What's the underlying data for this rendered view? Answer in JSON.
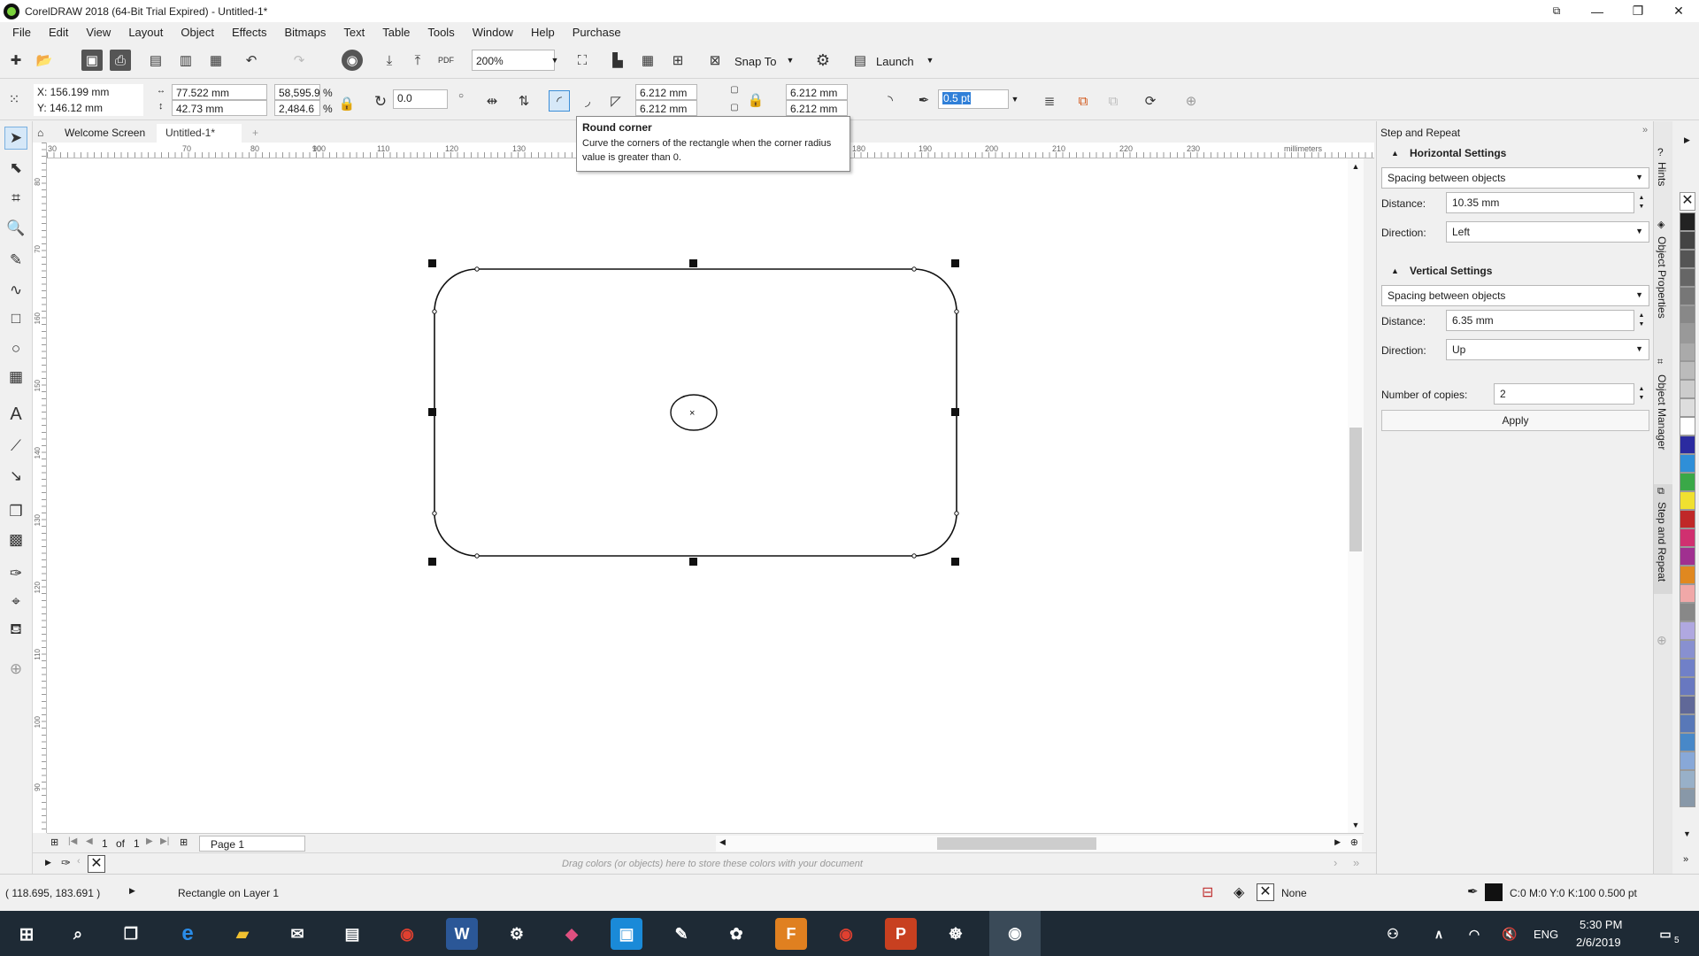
{
  "window": {
    "title": "CorelDRAW 2018 (64-Bit Trial Expired) - Untitled-1*"
  },
  "menu": [
    "File",
    "Edit",
    "View",
    "Layout",
    "Object",
    "Effects",
    "Bitmaps",
    "Text",
    "Table",
    "Tools",
    "Window",
    "Help",
    "Purchase"
  ],
  "toolbar": {
    "zoom": "200%",
    "snap_to": "Snap To",
    "launch": "Launch"
  },
  "propbar": {
    "x": "X: 156.199 mm",
    "y": "Y: 146.12 mm",
    "width": "77.522 mm",
    "height": "42.73 mm",
    "scale_w": "58,595.9",
    "scale_h": "2,484.6",
    "pct": "%",
    "rotation": "0.0",
    "corner_tl": "6.212 mm",
    "corner_bl": "6.212 mm",
    "corner_tr": "6.212 mm",
    "corner_br": "6.212 mm",
    "outline_width": "0.5 pt"
  },
  "tooltip": {
    "title": "Round corner",
    "body": "Curve the corners of the rectangle when the corner radius value is greater than 0."
  },
  "tabs": {
    "welcome": "Welcome Screen",
    "doc": "Untitled-1*"
  },
  "ruler": {
    "unit": "millimeters",
    "h_labels": [
      "30",
      "70",
      "80",
      "90",
      "100",
      "110",
      "120",
      "130",
      "180",
      "190",
      "200",
      "210",
      "220",
      "230"
    ],
    "v_labels": [
      "80",
      "70",
      "160",
      "150",
      "140",
      "130",
      "120",
      "110",
      "100",
      "90"
    ]
  },
  "docker": {
    "title": "Step and Repeat",
    "horizontal_title": "Horizontal Settings",
    "h_mode": "Spacing between objects",
    "h_distance_label": "Distance:",
    "h_distance": "10.35 mm",
    "h_direction_label": "Direction:",
    "h_direction": "Left",
    "vertical_title": "Vertical Settings",
    "v_mode": "Spacing between objects",
    "v_distance_label": "Distance:",
    "v_distance": "6.35 mm",
    "v_direction_label": "Direction:",
    "v_direction": "Up",
    "copies_label": "Number of copies:",
    "copies": "2",
    "apply": "Apply"
  },
  "side_tabs": {
    "hints": "Hints",
    "object_properties": "Object Properties",
    "object_manager": "Object Manager",
    "step_repeat": "Step and Repeat"
  },
  "pagebar": {
    "current": "1",
    "of": "of",
    "total": "1",
    "page_tab": "Page 1"
  },
  "colorwell": {
    "hint": "Drag colors (or objects) here to store these colors with your document"
  },
  "status": {
    "coords": "( 118.695, 183.691 )",
    "selection": "Rectangle on Layer 1",
    "fill": "None",
    "outline": "C:0 M:0 Y:0 K:100  0.500 pt"
  },
  "taskbar": {
    "lang": "ENG",
    "time": "5:30 PM",
    "date": "2/6/2019",
    "notifications": "5"
  },
  "palette": [
    "#222222",
    "#444444",
    "#555555",
    "#666666",
    "#777777",
    "#888888",
    "#999999",
    "#aaaaaa",
    "#bbbbbb",
    "#cccccc",
    "#dddddd",
    "#ffffff",
    "#2b2ba0",
    "#2f8fd8",
    "#3aa848",
    "#f0e030",
    "#c02828",
    "#d03070",
    "#a03090",
    "#e08820",
    "#f0a8a8",
    "#888888",
    "#b0a8e0",
    "#8890d0",
    "#7080c8",
    "#6878c0",
    "#606898",
    "#5878b8",
    "#4888c8",
    "#88a8d8",
    "#98b0c8",
    "#8898a8"
  ]
}
